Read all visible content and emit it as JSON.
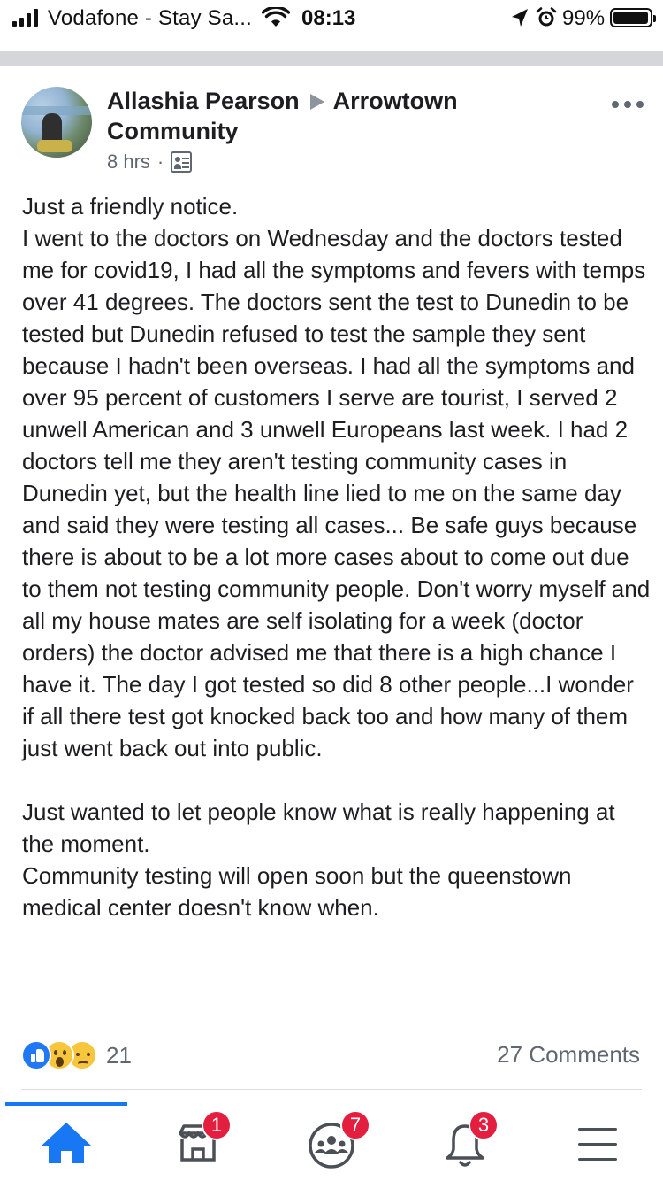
{
  "status_bar": {
    "carrier": "Vodafone - Stay Sa...",
    "time": "08:13",
    "battery": "99%",
    "battery_level": 0.99,
    "icons": [
      "signal-icon",
      "wifi-icon",
      "location-arrow-icon",
      "alarm-icon",
      "battery-icon"
    ]
  },
  "post": {
    "author": "Allashia Pearson",
    "group": "Arrowtown Community",
    "time": "8 hrs",
    "separator": "·",
    "audience_icon": "group-icon",
    "paragraphs": [
      "Just a friendly notice.",
      "I went to the doctors on Wednesday and the doctors tested me for covid19, I had all the symptoms and fevers with temps over 41 degrees. The doctors sent the test to Dunedin to be tested but Dunedin refused to test the sample they sent because I hadn't been overseas. I had all the symptoms and over 95 percent of customers I serve are tourist, I served 2 unwell American and 3 unwell Europeans last week. I had 2 doctors tell me they aren't testing community cases in Dunedin yet, but the health line lied to me on the same day and said they were testing all cases... Be safe guys because there is about to be a lot more cases about to come out due to them not testing community people. Don't worry myself and all my house mates are self isolating for a week (doctor orders) the doctor advised me that there is a high chance I have it. The day I got tested so did 8 other people...I wonder if all there test got knocked back too and how many of them just went back out into public.",
      "Just wanted to let people know what is really happening at the moment.",
      "Community testing will open soon but the queenstown medical center doesn't know when."
    ],
    "reaction_count": "21",
    "reactions": [
      "like-icon",
      "wow-icon",
      "sad-icon"
    ],
    "comments": "27 Comments"
  },
  "tabbar": {
    "tabs": [
      {
        "name": "home",
        "icon": "home-icon",
        "badge": ""
      },
      {
        "name": "marketplace",
        "icon": "marketplace-icon",
        "badge": "1"
      },
      {
        "name": "groups",
        "icon": "groups-icon",
        "badge": "7"
      },
      {
        "name": "notifications",
        "icon": "bell-icon",
        "badge": "3"
      },
      {
        "name": "menu",
        "icon": "menu-icon",
        "badge": ""
      }
    ]
  },
  "colors": {
    "accent": "#1877f2",
    "badge": "#e41e3f",
    "text": "#1c1e21",
    "secondary_text": "#606770"
  }
}
